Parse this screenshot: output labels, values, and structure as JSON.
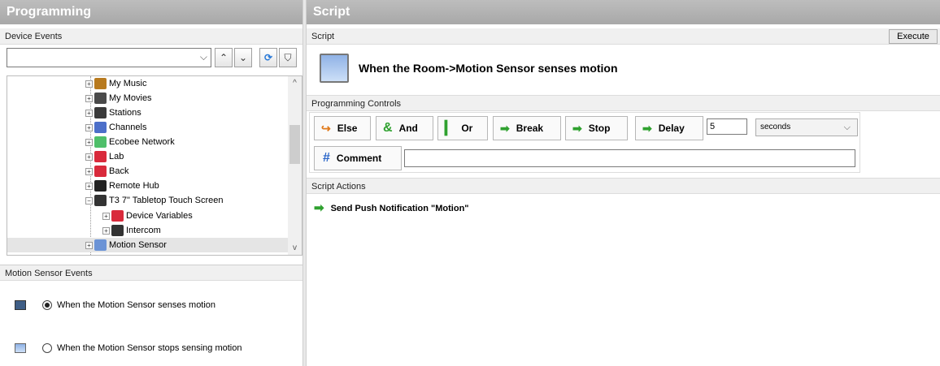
{
  "left_panel": {
    "title": "Programming",
    "device_events_label": "Device Events",
    "search_value": "",
    "tree": [
      {
        "label": "My Music",
        "icon": "music-icon",
        "color": "#b87a1e"
      },
      {
        "label": "My Movies",
        "icon": "movies-icon",
        "color": "#4a4a4a"
      },
      {
        "label": "Stations",
        "icon": "stations-icon",
        "color": "#3a3a3a"
      },
      {
        "label": "Channels",
        "icon": "channels-icon",
        "color": "#4c6fc9"
      },
      {
        "label": "Ecobee Network",
        "icon": "ecobee-icon",
        "color": "#4fbf6a"
      },
      {
        "label": "Lab",
        "icon": "control4-icon",
        "color": "#d92a3b"
      },
      {
        "label": "Back",
        "icon": "control4-icon",
        "color": "#d92a3b"
      },
      {
        "label": "Remote Hub",
        "icon": "remote-hub-icon",
        "color": "#222222"
      },
      {
        "label": "T3 7\" Tabletop Touch Screen",
        "icon": "touch-screen-icon",
        "color": "#333333"
      },
      {
        "label": "Device Variables",
        "icon": "control4-icon",
        "color": "#d92a3b"
      },
      {
        "label": "Intercom",
        "icon": "intercom-icon",
        "color": "#333333"
      },
      {
        "label": "Motion Sensor",
        "icon": "motion-sensor-icon",
        "color": "#6b93d6"
      }
    ],
    "events_label": "Motion Sensor Events",
    "events": [
      {
        "label": "When the Motion Sensor senses motion",
        "selected": true
      },
      {
        "label": "When the Motion Sensor stops sensing motion",
        "selected": false
      }
    ]
  },
  "right_panel": {
    "title": "Script",
    "script_label": "Script",
    "execute_label": "Execute",
    "script_title": "When the Room->Motion Sensor senses motion",
    "controls_label": "Programming Controls",
    "controls": {
      "else": "Else",
      "and": "And",
      "or": "Or",
      "break": "Break",
      "stop": "Stop",
      "delay": "Delay",
      "delay_value": "5",
      "delay_unit": "seconds",
      "comment": "Comment",
      "comment_value": ""
    },
    "actions_label": "Script Actions",
    "actions": [
      "Send Push Notification \"Motion\""
    ]
  }
}
